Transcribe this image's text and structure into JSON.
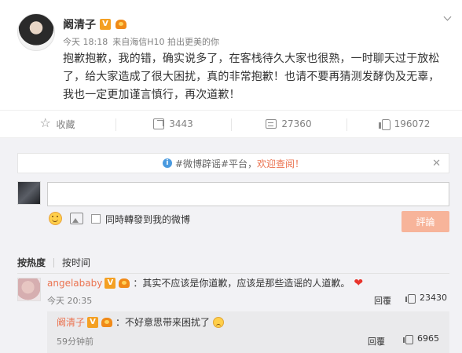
{
  "post": {
    "author": "阚清子",
    "meta_time": "今天 18:18",
    "meta_source": "来自海信H10 拍出更美的你",
    "text": "抱歉抱歉，我的错，确实说多了，在客栈待久大家也很熟，一时聊天过于放松了，给大家造成了很大困扰，真的非常抱歉！也请不要再猜测发酵伪及无辜，我也一定更加谨言慎行，再次道歉！"
  },
  "badges": {
    "verified": "V"
  },
  "actions": {
    "favorite_label": "收藏",
    "repost_count": "3443",
    "comment_count": "27360",
    "like_count": "196072"
  },
  "rumor_bar": {
    "text": "#微博辟谣#平台，",
    "link": "欢迎查阅！",
    "close": "✕",
    "info": "i"
  },
  "composer": {
    "input_value": "",
    "placeholder": "",
    "sync_label": "同時轉發到我的微博",
    "submit_label": "評論"
  },
  "sort": {
    "hot": "按热度",
    "time": "按时间"
  },
  "comments": [
    {
      "user": "angelababy",
      "text": "：其实不应该是你道歉，应该是那些造谣的人道歉。",
      "emoji": "❤",
      "time": "今天 20:35",
      "reply_label": "回覆",
      "likes": "23430",
      "replies": [
        {
          "user": "阚清子",
          "text": "：不好意思带来困扰了",
          "time": "59分钟前",
          "reply_label": "回覆",
          "likes": "6965"
        }
      ]
    }
  ],
  "colors": {
    "accent_orange": "#eb7350",
    "submit_disabled": "#f7b49a",
    "verified_badge": "#f4a023",
    "info_blue": "#4a9adf"
  },
  "icons": [
    "more-chevron-icon",
    "favorite-icon",
    "repost-icon",
    "comment-icon",
    "like-icon",
    "emoji-icon",
    "image-icon",
    "info-icon",
    "close-icon"
  ]
}
